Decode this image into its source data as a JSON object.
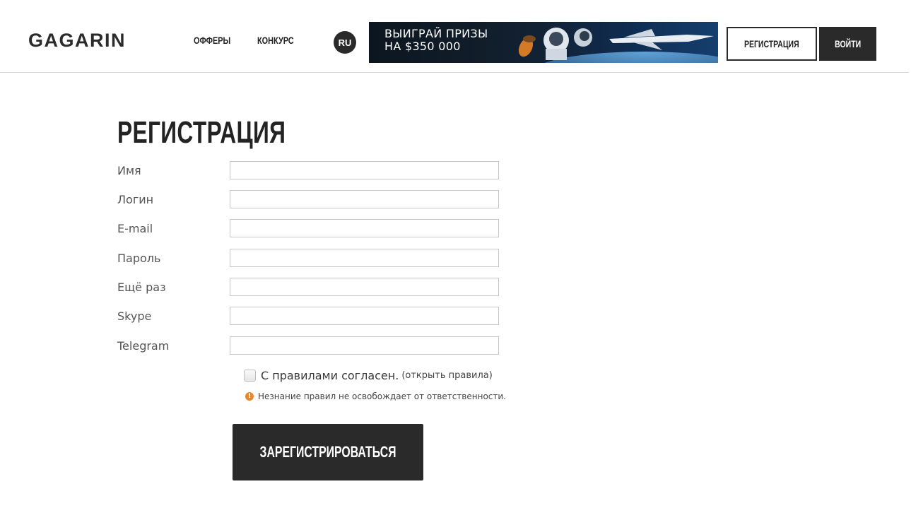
{
  "header": {
    "logo": "GAGARIN",
    "nav": {
      "offers": "ОФФЕРЫ",
      "contest": "КОНКУРС"
    },
    "lang": "RU",
    "banner": {
      "line1": "ВЫИГРАЙ ПРИЗЫ",
      "line2": "НА $350 000"
    },
    "register_button": "РЕГИСТРАЦИЯ",
    "login_button": "ВОЙТИ"
  },
  "form": {
    "title": "РЕГИСТРАЦИЯ",
    "fields": [
      {
        "label": "Имя",
        "value": ""
      },
      {
        "label": "Логин",
        "value": ""
      },
      {
        "label": "E-mail",
        "value": ""
      },
      {
        "label": "Пароль",
        "value": ""
      },
      {
        "label": "Ещё раз",
        "value": ""
      },
      {
        "label": "Skype",
        "value": ""
      },
      {
        "label": "Telegram",
        "value": ""
      }
    ],
    "agree_text": "С правилами согласен.",
    "agree_link": "(открыть правила)",
    "agree_checked": false,
    "warning": "Незнание правил не освобождает от ответственности.",
    "submit": "ЗАРЕГИСТРИРОВАТЬСЯ"
  },
  "colors": {
    "dark": "#2a2a2a",
    "warning": "#e8862a",
    "divider": "#d6d6d6"
  }
}
